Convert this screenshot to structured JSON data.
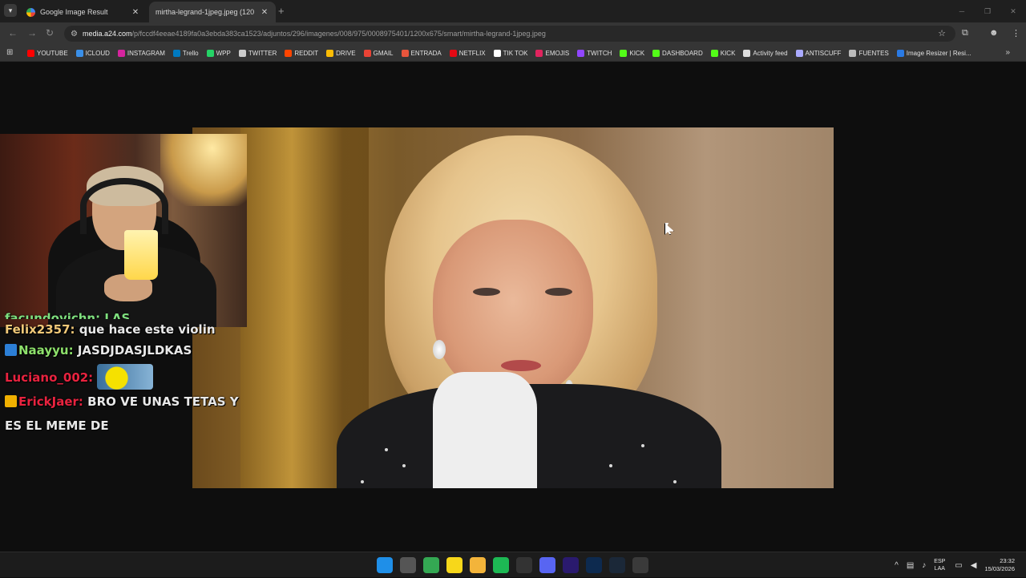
{
  "browser": {
    "tabs": [
      {
        "title": "Google Image Result",
        "active": false
      },
      {
        "title": "mirtha-legrand-1jpeg.jpeg (120",
        "active": true
      }
    ],
    "url_host": "media.a24.com",
    "url_path": "/p/fccdf4eeae4189fa0a3ebda383ca1523/adjuntos/296/imagenes/008/975/0008975401/1200x675/smart/mirtha-legrand-1jpeg.jpeg"
  },
  "bookmarks": [
    {
      "label": "YOUTUBE",
      "color": "#ff0000"
    },
    {
      "label": "ICLOUD",
      "color": "#3a8fe8"
    },
    {
      "label": "INSTAGRAM",
      "color": "#d6249f"
    },
    {
      "label": "Trello",
      "color": "#0079bf"
    },
    {
      "label": "WPP",
      "color": "#25d366"
    },
    {
      "label": "TWITTER",
      "color": "#cccccc"
    },
    {
      "label": "REDDIT",
      "color": "#ff4500"
    },
    {
      "label": "DRIVE",
      "color": "#fbbc05"
    },
    {
      "label": "GMAIL",
      "color": "#ea4335"
    },
    {
      "label": "ENTRADA",
      "color": "#e8553c"
    },
    {
      "label": "NETFLIX",
      "color": "#e50914"
    },
    {
      "label": "TIK TOK",
      "color": "#ffffff"
    },
    {
      "label": "EMOJIS",
      "color": "#e0245e"
    },
    {
      "label": "TWITCH",
      "color": "#9146ff"
    },
    {
      "label": "KICK",
      "color": "#53fc18"
    },
    {
      "label": "DASHBOARD",
      "color": "#53fc18"
    },
    {
      "label": "KICK",
      "color": "#53fc18"
    },
    {
      "label": "Activity feed",
      "color": "#dddddd"
    },
    {
      "label": "ANTISCUFF",
      "color": "#aaaaff"
    },
    {
      "label": "FUENTES",
      "color": "#bbbbbb"
    },
    {
      "label": "Image Resizer | Resi...",
      "color": "#2a7ae4"
    }
  ],
  "chat": {
    "partial_line": "facundovichn: LAS",
    "messages": [
      {
        "user": "Felix2357:",
        "user_color": "#f0c878",
        "text": "que hace este violin",
        "badge": null
      },
      {
        "user": "Naayyu:",
        "user_color": "#8de06b",
        "text": "JASDJDASJLDKAS",
        "badge": "#2c7fd6"
      },
      {
        "user": "Luciano_002:",
        "user_color": "#e8233f",
        "text": "",
        "badge": null,
        "emote": true
      },
      {
        "user": "ErickJaer:",
        "user_color": "#e8233f",
        "text": "BRO VE UNAS TETAS Y",
        "badge": "#f0b000"
      }
    ],
    "continuation": "ES EL MEME DE"
  },
  "taskbar": {
    "icons": [
      {
        "name": "windows-start",
        "color": "#1f8fe8"
      },
      {
        "name": "task-manager",
        "color": "#555555"
      },
      {
        "name": "chrome",
        "color": "#34a853"
      },
      {
        "name": "sticky-notes",
        "color": "#f7d71a"
      },
      {
        "name": "file-explorer",
        "color": "#f3b43a"
      },
      {
        "name": "spotify",
        "color": "#1db954"
      },
      {
        "name": "obs",
        "color": "#333333"
      },
      {
        "name": "discord",
        "color": "#5865f2"
      },
      {
        "name": "premiere",
        "color": "#2a1a6e"
      },
      {
        "name": "photoshop",
        "color": "#0d2a4f"
      },
      {
        "name": "steam",
        "color": "#1b2838"
      },
      {
        "name": "app",
        "color": "#3a3a3a"
      }
    ],
    "lang_top": "ESP",
    "lang_bottom": "LAA",
    "time": "23:32",
    "date": "15/03/2026"
  }
}
